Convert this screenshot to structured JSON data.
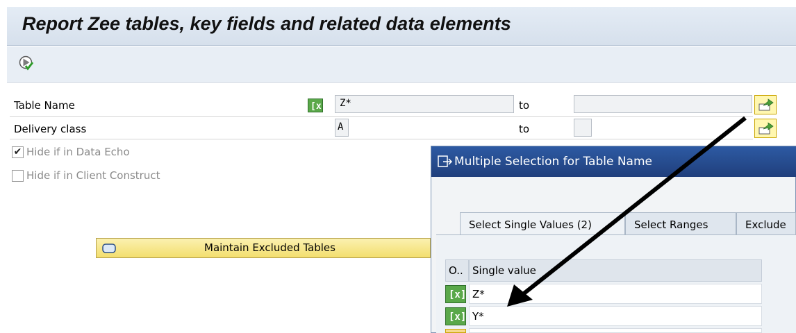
{
  "report": {
    "title": "Report Zee tables, key fields and related data elements"
  },
  "toolbar": {
    "execute_icon": "execute-icon"
  },
  "selection": {
    "table_name_label": "Table Name",
    "table_name_value": "Z*",
    "table_name_to_label": "to",
    "table_name_to_value": "",
    "delivery_class_label": "Delivery class",
    "delivery_class_value": "A",
    "delivery_class_to_label": "to",
    "delivery_class_to_value": ""
  },
  "options": {
    "hide_data_echo_label": "Hide if in Data Echo",
    "hide_data_echo_checked": true,
    "hide_client_construct_label": "Hide if in Client Construct",
    "hide_client_construct_checked": false
  },
  "buttons": {
    "maintain_excluded": "Maintain Excluded Tables"
  },
  "dialog": {
    "title": "Multiple Selection for Table Name",
    "tabs": [
      {
        "label": "Select Single Values (2)"
      },
      {
        "label": "Select Ranges"
      },
      {
        "label": "Exclude"
      }
    ],
    "table": {
      "col_option": "O..",
      "col_value": "Single value",
      "rows": [
        {
          "value": "Z*"
        },
        {
          "value": "Y*"
        },
        {
          "value": ""
        }
      ]
    }
  },
  "colors": {
    "accent_title": "#203f7c",
    "green_icon": "#5aa84a",
    "yellow_button": "#f3de6e"
  }
}
